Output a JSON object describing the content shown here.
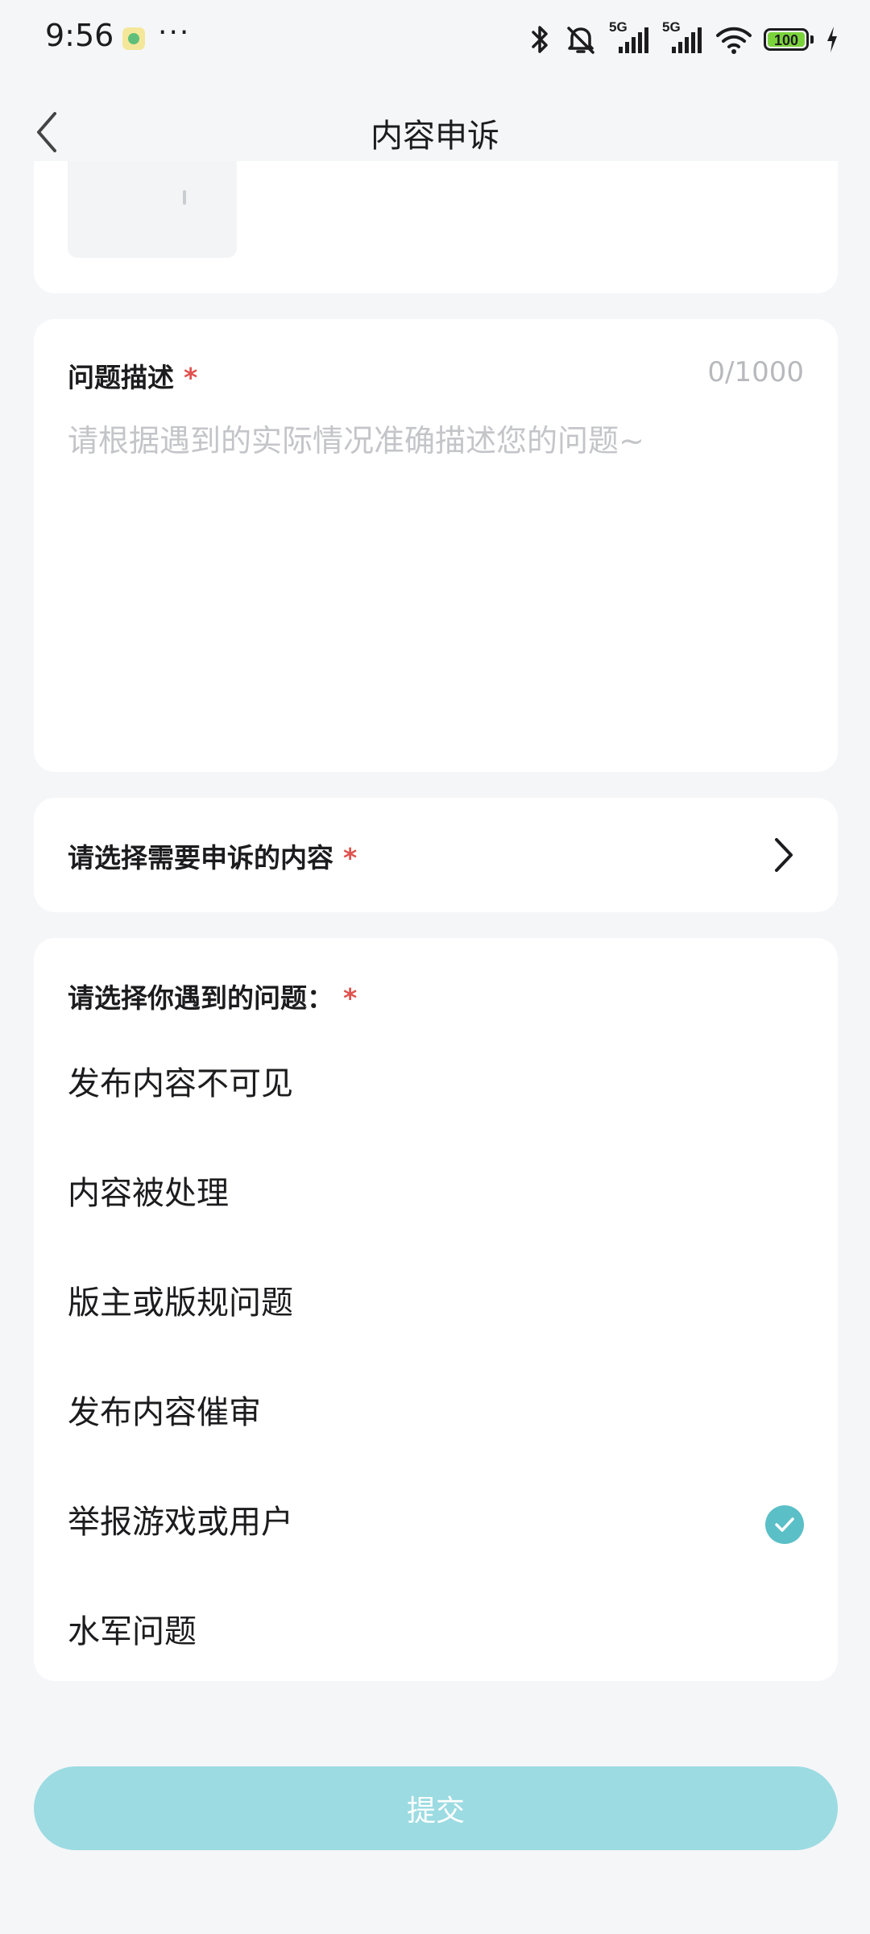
{
  "status_bar": {
    "time": "9:56",
    "dots": "···",
    "network_1": "5G",
    "network_2": "5G",
    "battery_level": "100",
    "icons": [
      "app-notification-icon",
      "bluetooth-icon",
      "mute-bell-icon",
      "signal-icon",
      "wifi-icon",
      "battery-icon",
      "charging-icon"
    ]
  },
  "header": {
    "title": "内容申诉",
    "back_icon": "chevron-left-icon"
  },
  "description": {
    "label": "问题描述",
    "required_mark": "*",
    "counter": "0/1000",
    "placeholder": "请根据遇到的实际情况准确描述您的问题~",
    "value": ""
  },
  "content_select": {
    "label": "请选择需要申诉的内容",
    "required_mark": "*",
    "icon": "chevron-right-icon"
  },
  "problems": {
    "label": "请选择你遇到的问题：",
    "required_mark": "*",
    "options": [
      {
        "label": "发布内容不可见",
        "selected": false
      },
      {
        "label": "内容被处理",
        "selected": false
      },
      {
        "label": "版主或版规问题",
        "selected": false
      },
      {
        "label": "发布内容催审",
        "selected": false
      },
      {
        "label": "举报游戏或用户",
        "selected": true
      },
      {
        "label": "水军问题",
        "selected": false
      }
    ],
    "selected_icon": "check-circle-icon"
  },
  "submit": {
    "label": "提交"
  },
  "colors": {
    "background": "#f5f6f8",
    "card": "#ffffff",
    "accent": "#5bbfc7",
    "submit_disabled": "#9cdbe2",
    "required": "#e0524f",
    "placeholder": "#c4c5c9"
  }
}
